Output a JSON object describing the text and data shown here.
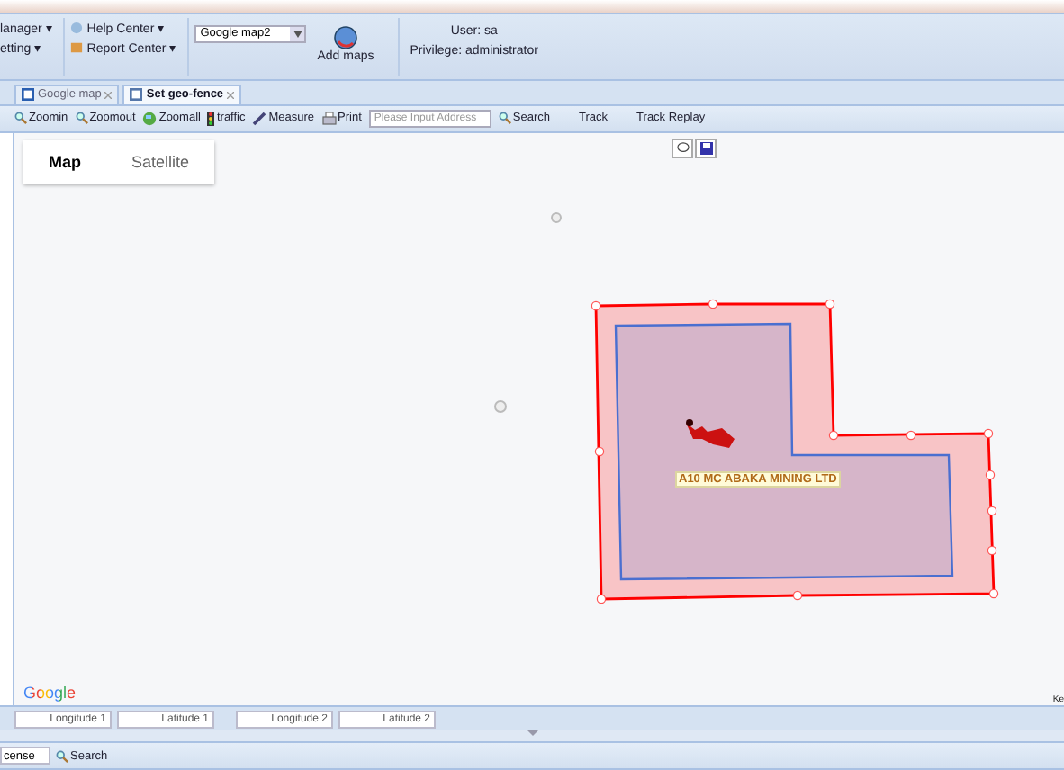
{
  "ribbon": {
    "menus_left": [
      {
        "label": "lanager ▾"
      },
      {
        "label": "etting ▾"
      }
    ],
    "menus_center": [
      {
        "label": "Help Center ▾"
      },
      {
        "label": "Report Center ▾"
      }
    ],
    "map_select": {
      "value": "Google map2"
    },
    "add_maps": {
      "label": "Add maps"
    },
    "user": {
      "name": "User: sa",
      "privilege": "Privilege: administrator"
    }
  },
  "tabs": [
    {
      "label": "Google map",
      "selected": false
    },
    {
      "label": "Set geo-fence",
      "selected": true
    }
  ],
  "toolbar": [
    {
      "label": "Zoomin",
      "kind": "zoomin"
    },
    {
      "label": "Zoomout",
      "kind": "zoomout"
    },
    {
      "label": "Zoomall",
      "kind": "globe"
    },
    {
      "label": "traffic",
      "kind": "traffic"
    },
    {
      "label": "Measure",
      "kind": "ruler"
    },
    {
      "label": "Print",
      "kind": "printer"
    }
  ],
  "address": {
    "placeholder": "Please Input Address"
  },
  "toolbar_right": [
    {
      "label": "Search",
      "kind": "search"
    },
    {
      "label": "Track",
      "kind": "none"
    },
    {
      "label": "Track Replay",
      "kind": "none"
    }
  ],
  "map": {
    "types": [
      {
        "label": "Map",
        "selected": true
      },
      {
        "label": "Satellite",
        "selected": false
      }
    ],
    "vehicle_label": "A10 MC ABAKA MINING LTD",
    "logo": "Google",
    "corner_text": "Ke"
  },
  "coords": [
    {
      "placeholder": "Longitude 1"
    },
    {
      "placeholder": "Latitude 1"
    },
    {
      "placeholder": "Longitude 2"
    },
    {
      "placeholder": "Latitude 2"
    }
  ],
  "bottom": {
    "field_value": "cense",
    "search": "Search"
  }
}
